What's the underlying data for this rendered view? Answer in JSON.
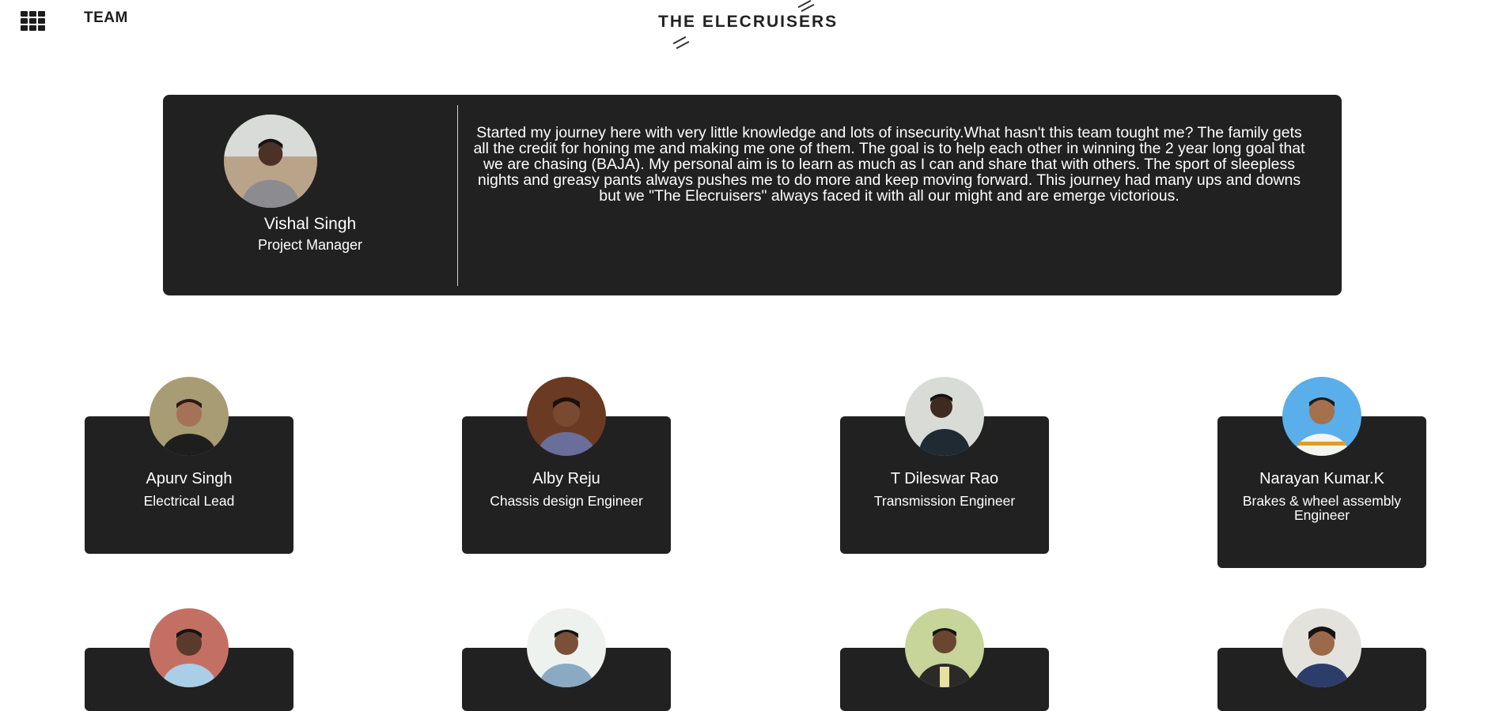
{
  "header": {
    "menu_icon": "grid-menu-icon",
    "nav_title": "TEAM",
    "brand": "THE ELECRUISERS"
  },
  "featured": {
    "name": "Vishal Singh",
    "role": "Project Manager",
    "quote": "Started my journey here with very little knowledge and lots of insecurity.What hasn't this team tought me? The family gets all the credit for honing me and making me one of them. The goal is to help each other in winning the 2 year long goal that we are chasing (BAJA). My personal aim is to learn as much as I can and share that with others. The sport of sleepless nights and greasy pants always pushes me to do more and keep moving forward. This journey had many ups and downs but we \"The Elecruisers\" always faced it with all our might and are emerge victorious."
  },
  "members": [
    {
      "name": "Apurv Singh",
      "role": "Electrical Lead"
    },
    {
      "name": "Alby Reju",
      "role": "Chassis design Engineer"
    },
    {
      "name": "T Dileswar Rao",
      "role": "Transmission Engineer"
    },
    {
      "name": "Narayan Kumar.K",
      "role": "Brakes & wheel assembly Engineer"
    },
    {
      "name": "",
      "role": ""
    },
    {
      "name": "",
      "role": ""
    },
    {
      "name": "",
      "role": ""
    },
    {
      "name": "",
      "role": ""
    }
  ],
  "colors": {
    "card_bg": "#212121",
    "text": "#ffffff",
    "page_bg": "#ffffff"
  }
}
